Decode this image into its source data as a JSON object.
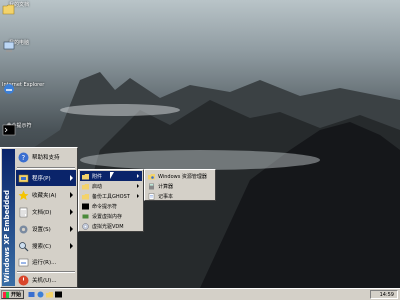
{
  "desktop": {
    "icons": [
      {
        "label": "我的文档",
        "icon": "folder-icon"
      },
      {
        "label": "我的电脑",
        "icon": "computer-icon"
      },
      {
        "label": "Internet Explorer",
        "icon": "ie-icon"
      },
      {
        "label": "命令提示符",
        "icon": "console-icon"
      }
    ]
  },
  "start_menu": {
    "brand": "Windows XP Embedded",
    "items": [
      {
        "label": "帮助和支持",
        "icon": "help-icon"
      },
      {
        "label": "程序(P)",
        "icon": "programs-icon"
      },
      {
        "label": "收藏夹(A)",
        "icon": "star-icon"
      },
      {
        "label": "文档(D)",
        "icon": "document-icon"
      },
      {
        "label": "设置(S)",
        "icon": "gear-icon"
      },
      {
        "label": "搜索(C)",
        "icon": "search-icon"
      },
      {
        "label": "运行(R)...",
        "icon": "run-icon"
      },
      {
        "label": "关机(U)...",
        "icon": "power-icon"
      }
    ]
  },
  "programs_menu": {
    "items": [
      {
        "label": "附件",
        "icon": "folder-icon"
      },
      {
        "label": "启动",
        "icon": "folder-icon"
      },
      {
        "label": "备份工具GHOST",
        "icon": "folder-icon"
      },
      {
        "label": "命令提示符",
        "icon": "console-icon"
      },
      {
        "label": "设置虚拟内存",
        "icon": "memory-icon"
      },
      {
        "label": "虚拟光驱VDM",
        "icon": "disc-icon"
      }
    ]
  },
  "accessories_menu": {
    "items": [
      {
        "label": "Windows 资源管理器",
        "icon": "explorer-icon"
      },
      {
        "label": "计算器",
        "icon": "calculator-icon"
      },
      {
        "label": "记事本",
        "icon": "notepad-icon"
      }
    ]
  },
  "taskbar": {
    "start_label": "开始",
    "clock": "14:59"
  },
  "colors": {
    "selection": "#0a246a",
    "menu_bg": "#d4d0c8"
  }
}
